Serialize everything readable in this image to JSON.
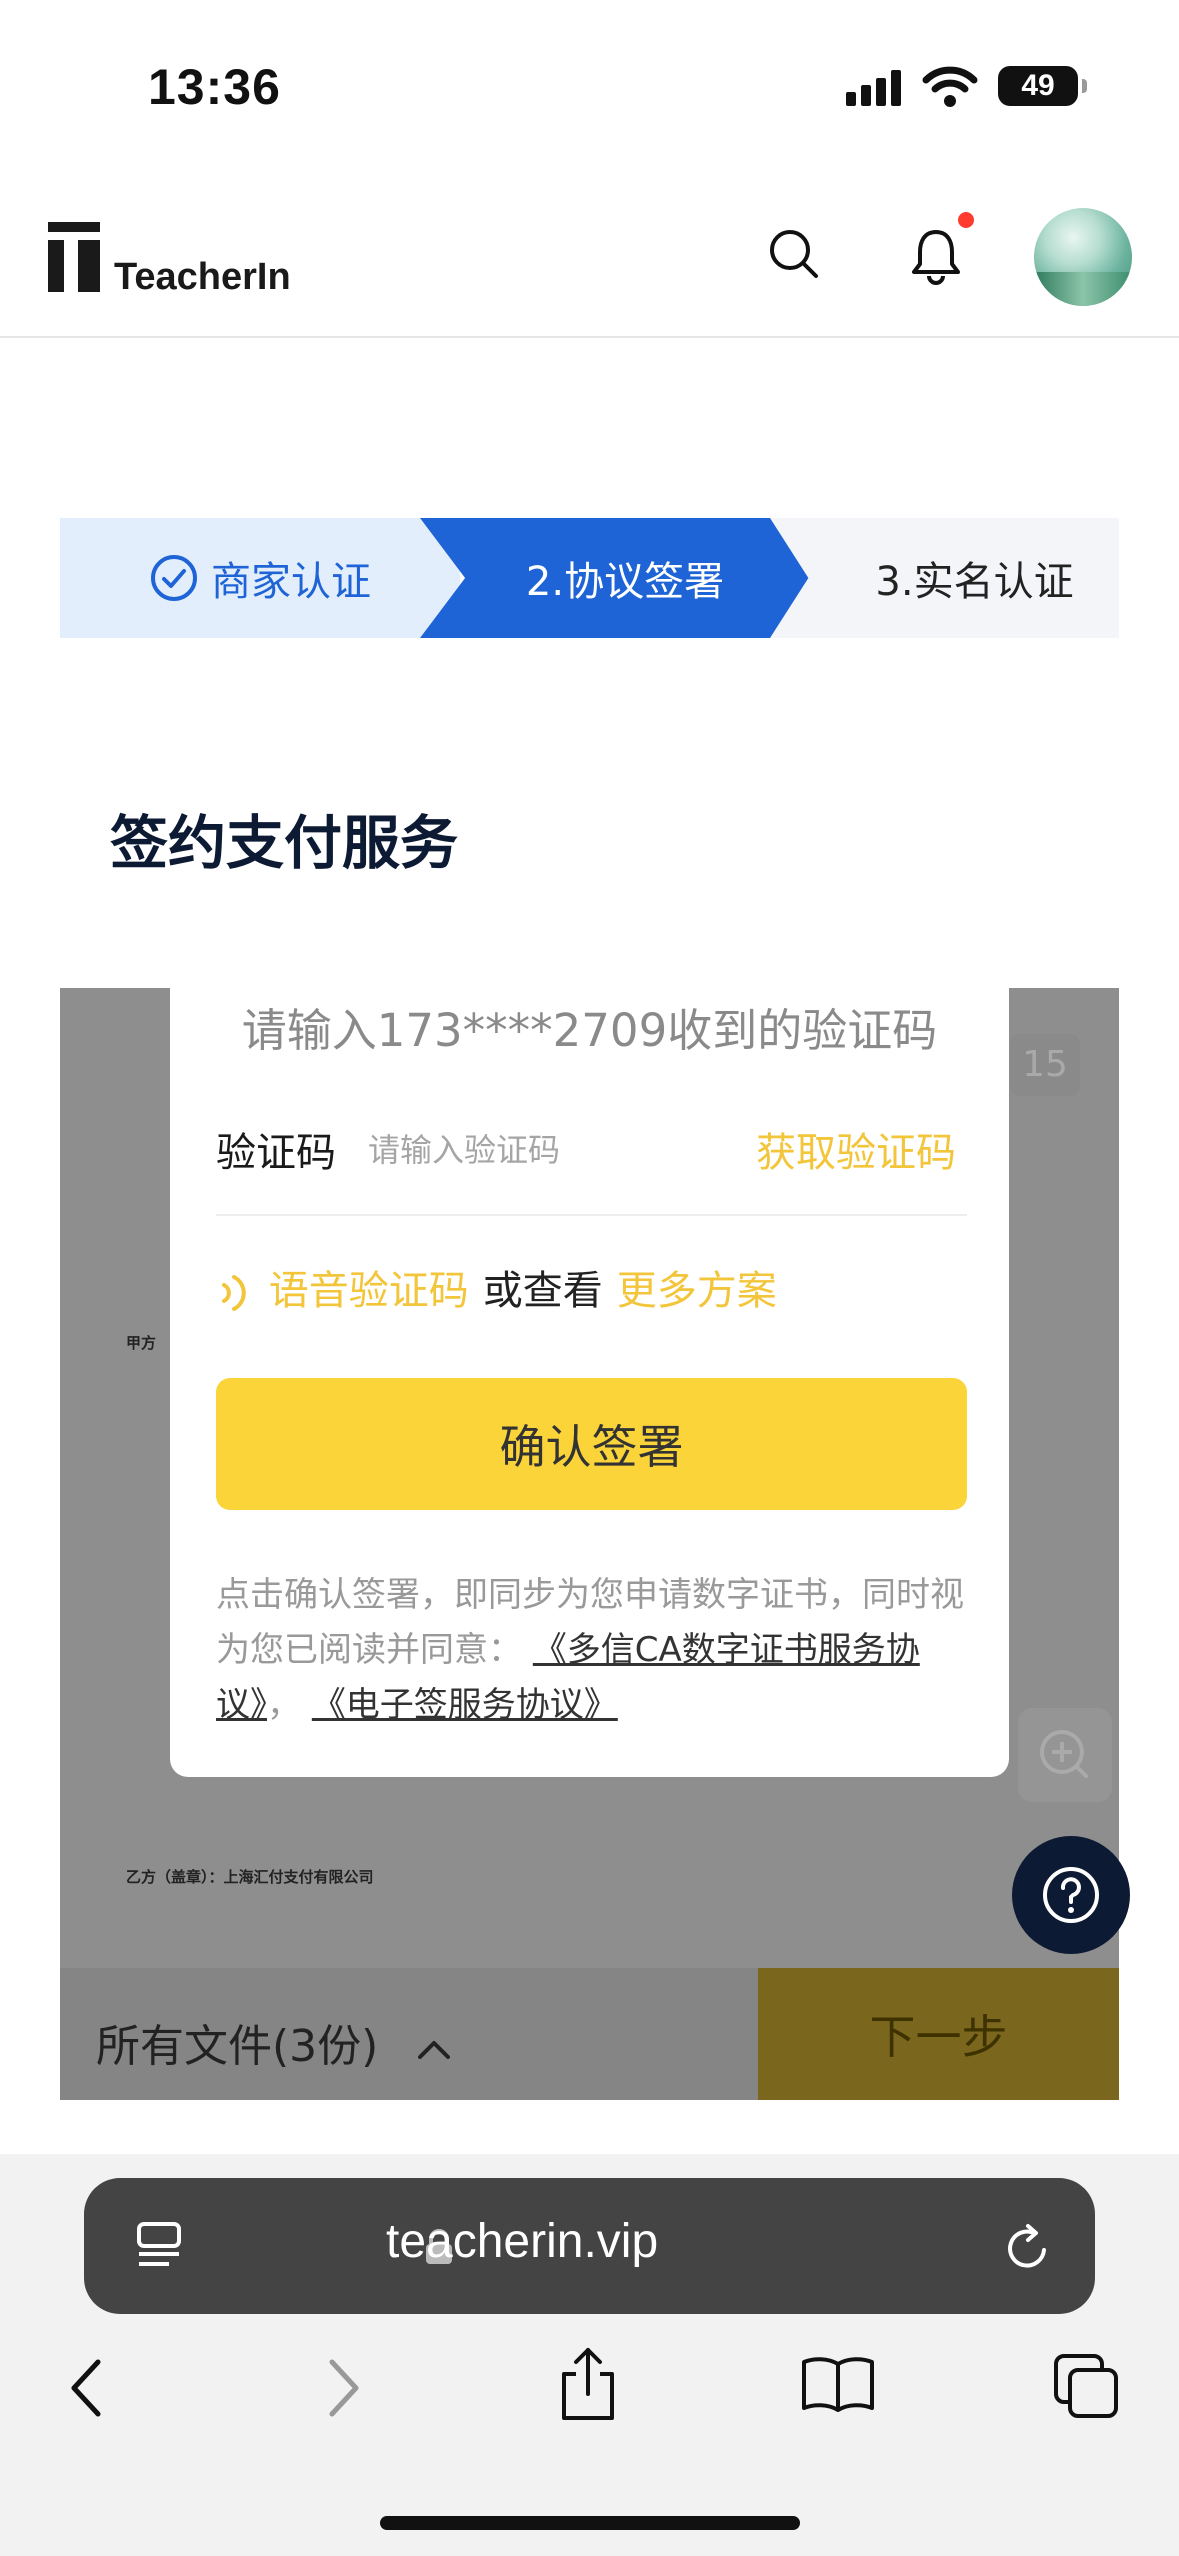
{
  "status_bar": {
    "time": "13:36",
    "battery": "49"
  },
  "header": {
    "logo_text": "TeacherIn"
  },
  "steps": [
    {
      "label": "商家认证",
      "state": "done"
    },
    {
      "label": "2.协议签署",
      "state": "active"
    },
    {
      "label": "3.实名认证",
      "state": "pending"
    }
  ],
  "page": {
    "title": "签约支付服务"
  },
  "document": {
    "page_count": "15",
    "party_a": "甲方",
    "party_b": "乙方（盖章）：上海汇付支付有限公司"
  },
  "modal": {
    "title": "请输入173****2709收到的验证码",
    "code_label": "验证码",
    "code_placeholder": "请输入验证码",
    "get_code": "获取验证码",
    "voice_code": "语音验证码",
    "or_view": "或查看",
    "more_options": "更多方案",
    "confirm": "确认签署",
    "legal_prefix": "点击确认签署，即同步为您申请数字证书，同时视为您已阅读并同意：",
    "legal_link_1": "《多信CA数字证书服务协议》",
    "legal_sep": "，",
    "legal_link_2": "《电子签服务协议》"
  },
  "bottom_bar": {
    "files": "所有文件(3份)",
    "next": "下一步"
  },
  "browser": {
    "url": "teacherin.vip"
  },
  "colors": {
    "primary_blue": "#1f64d6",
    "accent_yellow": "#fbd43a",
    "link_yellow": "#f2c53a",
    "navy": "#0d1a33"
  }
}
